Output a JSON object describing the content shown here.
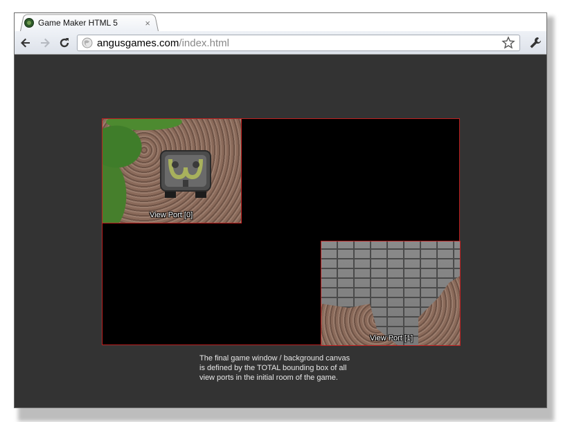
{
  "browser": {
    "tab": {
      "title": "Game Maker HTML 5",
      "close_glyph": "×"
    },
    "address": {
      "host": "angusgames.com",
      "path": "/index.html"
    },
    "icons": [
      "favicon-icon",
      "back-arrow-icon",
      "forward-arrow-icon",
      "reload-icon",
      "globe-icon",
      "bookmark-star-icon",
      "wrench-icon",
      "close-icon"
    ]
  },
  "game": {
    "viewports": [
      {
        "label": "View Port [0]"
      },
      {
        "label": "View Port [1]"
      }
    ],
    "caption": {
      "lines": [
        "The final game window / background canvas",
        "is defined by the TOTAL bounding box of all",
        "view ports in the initial room of the game."
      ]
    },
    "colors": {
      "border": "#c02020",
      "canvas": "#000000",
      "page_bg": "#333333"
    }
  }
}
